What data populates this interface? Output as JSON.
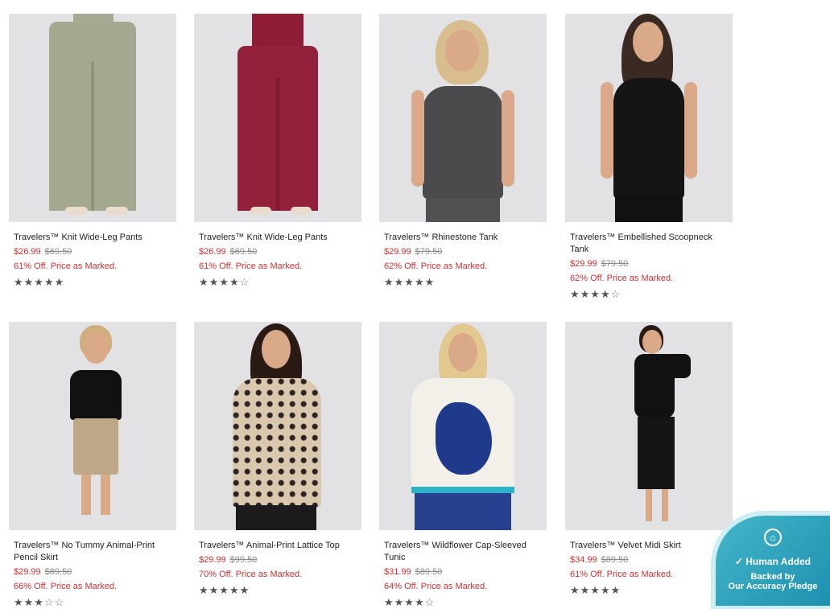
{
  "products": [
    {
      "name": "Travelers™ Knit Wide-Leg Pants",
      "sale": "$26.99",
      "orig": "$69.50",
      "promo": "61% Off. Price as Marked.",
      "stars": "★★★★★",
      "empty": ""
    },
    {
      "name": "Travelers™ Knit Wide-Leg Pants",
      "sale": "$26.99",
      "orig": "$69.50",
      "promo": "61% Off. Price as Marked.",
      "stars": "★★★★",
      "empty": "☆"
    },
    {
      "name": "Travelers™ Rhinestone Tank",
      "sale": "$29.99",
      "orig": "$79.50",
      "promo": "62% Off. Price as Marked.",
      "stars": "★★★★★",
      "empty": ""
    },
    {
      "name": "Travelers™ Embellished Scoopneck Tank",
      "sale": "$29.99",
      "orig": "$79.50",
      "promo": "62% Off. Price as Marked.",
      "stars": "★★★★",
      "empty": "☆"
    },
    {
      "name": "Travelers™ No Tummy Animal-Print Pencil Skirt",
      "sale": "$29.99",
      "orig": "$89.50",
      "promo": "66% Off. Price as Marked.",
      "stars": "★★★",
      "empty": "☆☆"
    },
    {
      "name": "Travelers™ Animal-Print Lattice Top",
      "sale": "$29.99",
      "orig": "$99.50",
      "promo": "70% Off. Price as Marked.",
      "stars": "★★★★★",
      "empty": ""
    },
    {
      "name": "Travelers™ Wildflower Cap-Sleeved Tunic",
      "sale": "$31.99",
      "orig": "$89.50",
      "promo": "64% Off. Price as Marked.",
      "stars": "★★★★",
      "empty": "☆"
    },
    {
      "name": "Travelers™ Velvet Midi Skirt",
      "sale": "$34.99",
      "orig": "$89.50",
      "promo": "61% Off. Price as Marked.",
      "stars": "★★★★★",
      "empty": ""
    }
  ],
  "badge": {
    "icon": "house-check-icon",
    "title": "Human Added",
    "line1": "Backed by",
    "line2": "Our Accuracy Pledge",
    "color": "#2a9fbd"
  }
}
